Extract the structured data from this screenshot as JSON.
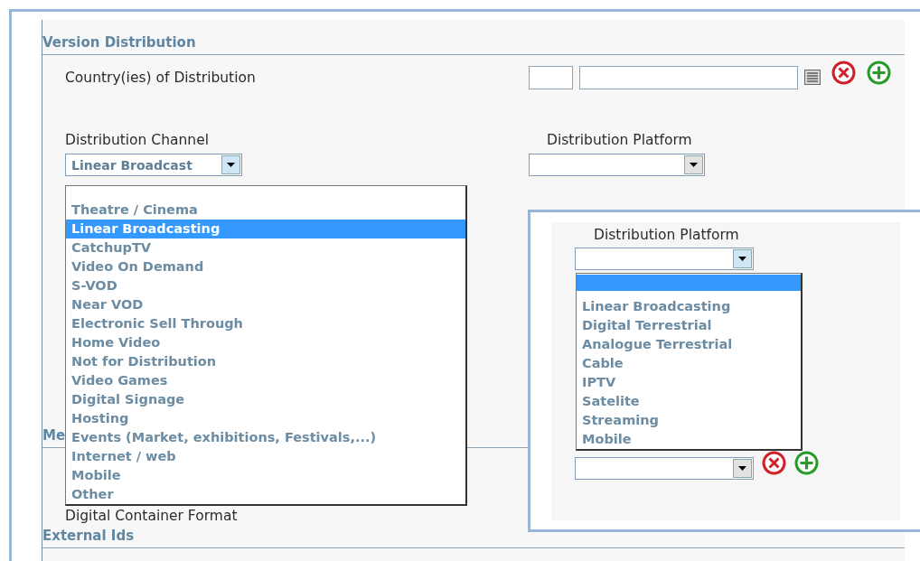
{
  "version_distribution": {
    "title": "Version Distribution",
    "country_label": "Country(ies) of Distribution",
    "channel_label": "Distribution Channel",
    "channel_value": "Linear Broadcast",
    "platform_label": "Distribution Platform"
  },
  "channel_options": [
    {
      "label": "Theatre / Cinema",
      "selected": false
    },
    {
      "label": "Linear Broadcasting",
      "selected": true
    },
    {
      "label": "CatchupTV",
      "selected": false
    },
    {
      "label": "Video On Demand",
      "selected": false
    },
    {
      "label": "S-VOD",
      "selected": false
    },
    {
      "label": "Near VOD",
      "selected": false
    },
    {
      "label": "Electronic Sell Through",
      "selected": false
    },
    {
      "label": "Home Video",
      "selected": false
    },
    {
      "label": "Not for Distribution",
      "selected": false
    },
    {
      "label": "Video Games",
      "selected": false
    },
    {
      "label": "Digital Signage",
      "selected": false
    },
    {
      "label": "Hosting",
      "selected": false
    },
    {
      "label": "Events (Market, exhibitions, Festivals,...)",
      "selected": false
    },
    {
      "label": "Internet / web",
      "selected": false
    },
    {
      "label": "Mobile",
      "selected": false
    },
    {
      "label": "Other",
      "selected": false
    }
  ],
  "media_section": {
    "title": "Me",
    "field_label": "Digital Container Format"
  },
  "external_ids": {
    "title": "External Ids"
  },
  "platform_popup": {
    "label": "Distribution Platform",
    "blank_option_selected": true,
    "options": [
      {
        "label": "Linear Broadcasting",
        "selected": false
      },
      {
        "label": "Digital Terrestrial",
        "selected": false
      },
      {
        "label": "Analogue Terrestrial",
        "selected": false
      },
      {
        "label": "Cable",
        "selected": false
      },
      {
        "label": "IPTV",
        "selected": false
      },
      {
        "label": "Satelite",
        "selected": false
      },
      {
        "label": "Streaming",
        "selected": false
      },
      {
        "label": "Mobile",
        "selected": false
      }
    ]
  }
}
